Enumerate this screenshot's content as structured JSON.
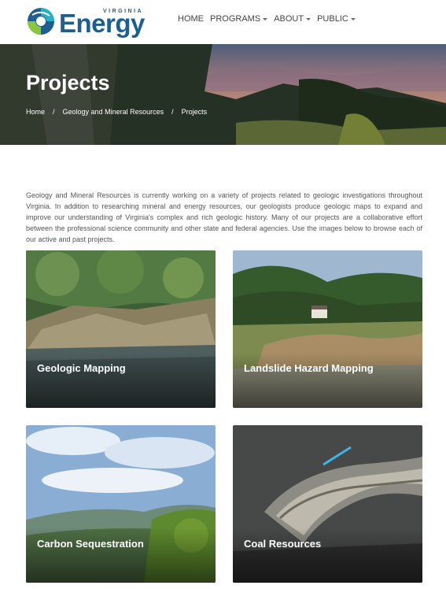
{
  "header": {
    "logo": {
      "small": "VIRGINIA",
      "big": "Energy"
    },
    "nav": [
      {
        "label": "HOME",
        "dropdown": false
      },
      {
        "label": "PROGRAMS",
        "dropdown": true
      },
      {
        "label": "ABOUT",
        "dropdown": true
      },
      {
        "label": "PUBLIC",
        "dropdown": true
      }
    ]
  },
  "hero": {
    "title": "Projects",
    "breadcrumb": [
      "Home",
      "Geology and Mineral Resources",
      "Projects"
    ],
    "separator": "/"
  },
  "intro": "Geology and Mineral Resources is currently working on a variety of projects related to geologic investigations throughout Virginia. In addition to researching mineral and energy resources, our geologists produce geologic maps to expand and improve our understanding of Virginia's complex and rich geologic history. Many of our projects are a collaborative effort between the professional science community and other state and federal agencies. Use the images below to browse each of our active and past projects.",
  "cards": [
    {
      "label": "Geologic Mapping"
    },
    {
      "label": "Landslide Hazard Mapping"
    },
    {
      "label": "Carbon Sequestration"
    },
    {
      "label": "Coal Resources"
    }
  ],
  "colors": {
    "brand_blue": "#1f5f8b",
    "brand_teal": "#2ab0c5",
    "brand_green": "#8cc63f"
  }
}
